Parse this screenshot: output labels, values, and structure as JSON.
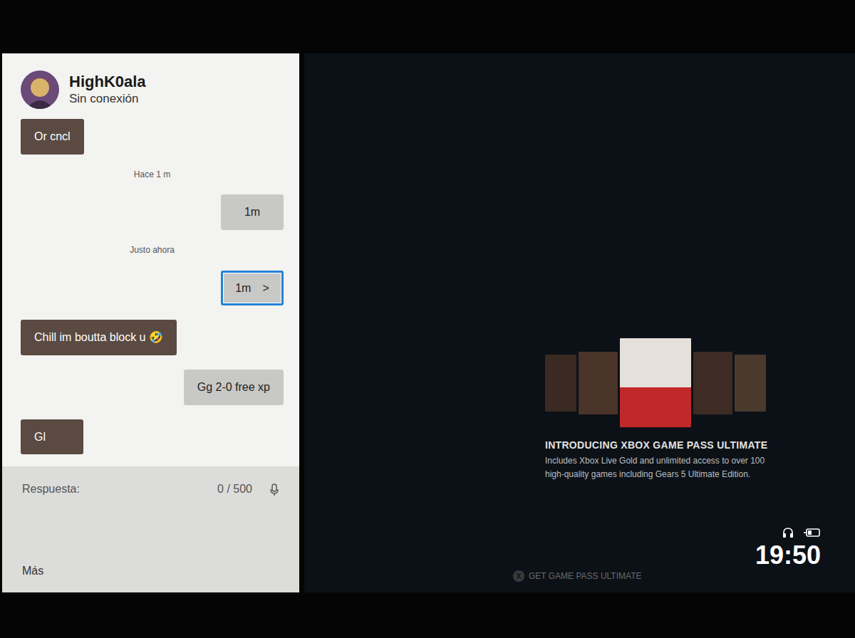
{
  "chat": {
    "contact": {
      "name": "HighK0ala",
      "status": "Sin conexión"
    },
    "messages": [
      {
        "kind": "received",
        "text": "Or cncl",
        "selected": false
      },
      {
        "kind": "timestamp",
        "text": "Hace 1 m",
        "selected": false
      },
      {
        "kind": "sent",
        "text": "1m",
        "selected": false
      },
      {
        "kind": "timestamp",
        "text": "Justo ahora",
        "selected": false
      },
      {
        "kind": "sent",
        "text": "1m",
        "selected": true,
        "arrow": ">"
      },
      {
        "kind": "received",
        "text": "Chill im boutta block u 🤣",
        "selected": false
      },
      {
        "kind": "sent",
        "text": "Gg 2-0 free xp",
        "selected": false
      },
      {
        "kind": "received",
        "text": "Gl",
        "selected": false
      }
    ],
    "reply": {
      "label": "Respuesta:",
      "count": "0 / 500"
    },
    "more": "Más"
  },
  "promo": {
    "title": "INTRODUCING XBOX GAME PASS ULTIMATE",
    "description": "Includes Xbox Live Gold and unlimited access to over 100 high-quality games including Gears 5 Ultimate Edition."
  },
  "bottom_actions": [
    {
      "button": "X",
      "label": "GET GAME PASS ULTIMATE"
    }
  ],
  "status_bar": {
    "time": "19:50"
  }
}
